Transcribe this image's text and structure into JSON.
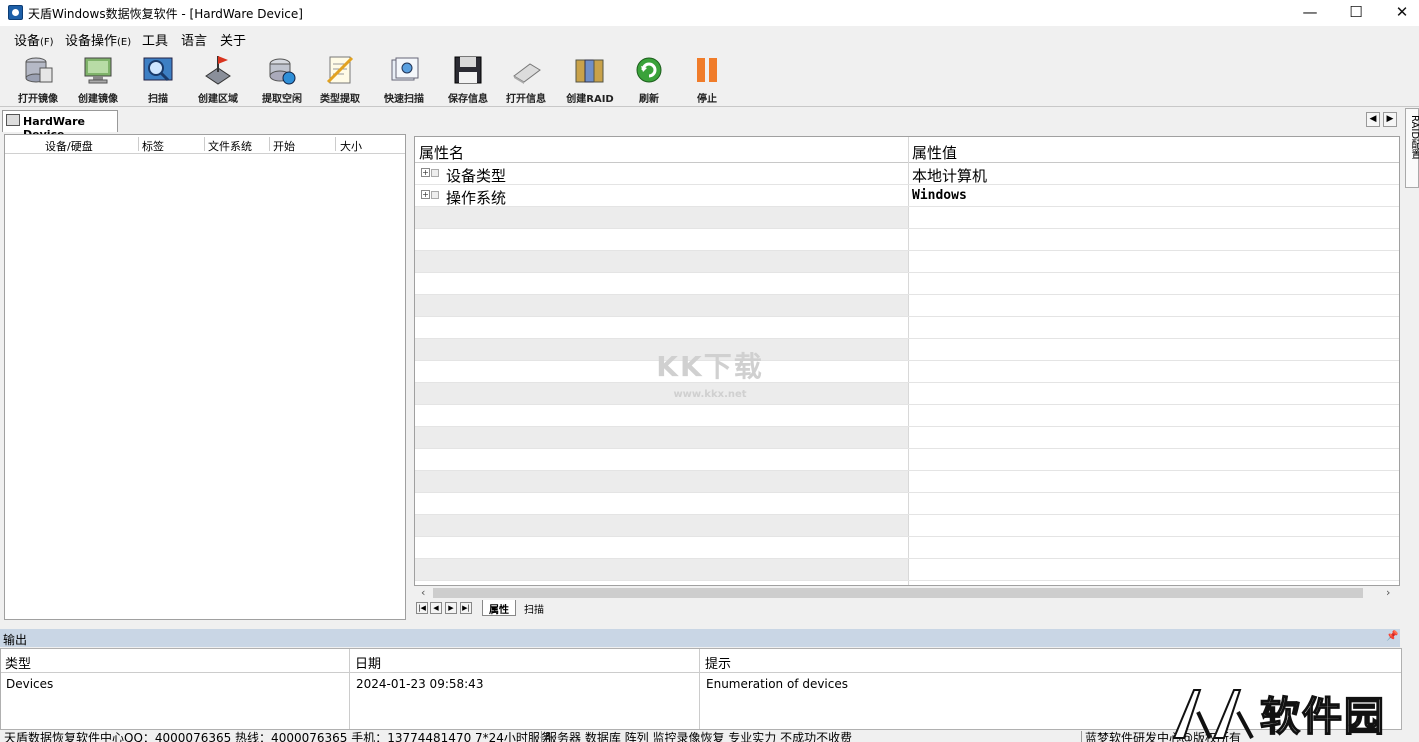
{
  "window": {
    "title": "天盾Windows数据恢复软件 - [HardWare Device]",
    "buttons": {
      "minimize": "—",
      "maximize": "☐",
      "close": "✕"
    }
  },
  "menu": [
    {
      "label": "设备",
      "key": "(F)"
    },
    {
      "label": "设备操作",
      "key": "(E)"
    },
    {
      "label": "工具",
      "key": ""
    },
    {
      "label": "语言",
      "key": ""
    },
    {
      "label": "关于",
      "key": ""
    }
  ],
  "toolbar": [
    {
      "label": "打开镜像",
      "icon": "open-image-icon"
    },
    {
      "label": "创建镜像",
      "icon": "create-image-icon"
    },
    {
      "label": "扫描",
      "icon": "scan-icon"
    },
    {
      "label": "创建区域",
      "icon": "create-region-icon"
    },
    {
      "label": "提取空闲",
      "icon": "extract-free-icon"
    },
    {
      "label": "类型提取",
      "icon": "type-extract-icon"
    },
    {
      "label": "快速扫描",
      "icon": "quick-scan-icon"
    },
    {
      "label": "保存信息",
      "icon": "save-info-icon"
    },
    {
      "label": "打开信息",
      "icon": "open-info-icon"
    },
    {
      "label": "创建RAID",
      "icon": "create-raid-icon"
    },
    {
      "label": "刷新",
      "icon": "refresh-icon"
    },
    {
      "label": "停止",
      "icon": "stop-icon"
    }
  ],
  "device_tab": {
    "label": "HardWare Device"
  },
  "side_strip": {
    "label": "RAID配置"
  },
  "left_panel": {
    "columns": [
      "设备/硬盘",
      "标签",
      "文件系统",
      "开始",
      "大小"
    ]
  },
  "properties": {
    "headers": {
      "name": "属性名",
      "value": "属性值"
    },
    "rows": [
      {
        "name": "设备类型",
        "value": "本地计算机"
      },
      {
        "name": "操作系统",
        "value": "Windows"
      }
    ]
  },
  "sheet_tabs": [
    {
      "label": "属性",
      "active": true
    },
    {
      "label": "扫描",
      "active": false
    }
  ],
  "watermark": {
    "main": "KK下载",
    "sub": "www.kkx.net"
  },
  "output": {
    "title": "输出",
    "columns": [
      "类型",
      "日期",
      "提示"
    ],
    "rows": [
      {
        "type": "Devices",
        "date": "2024-01-23 09:58:43",
        "hint": "Enumeration of devices"
      }
    ]
  },
  "status": {
    "contact": "天盾数据恢复软件中心QQ：4000076365 热线：4000076365 手机：13774481470 7*24小时服务",
    "services": "服务器 数据库 阵列 监控录像恢复 专业实力 不成功不收费",
    "copyright": "蓝梦软件研发中心@版权所有"
  },
  "corner_logo": {
    "text": "软件园"
  },
  "colors": {
    "output_bar": "#c9d6e5",
    "stop_icon": "#f07c2a",
    "refresh_icon": "#3aa23a"
  }
}
